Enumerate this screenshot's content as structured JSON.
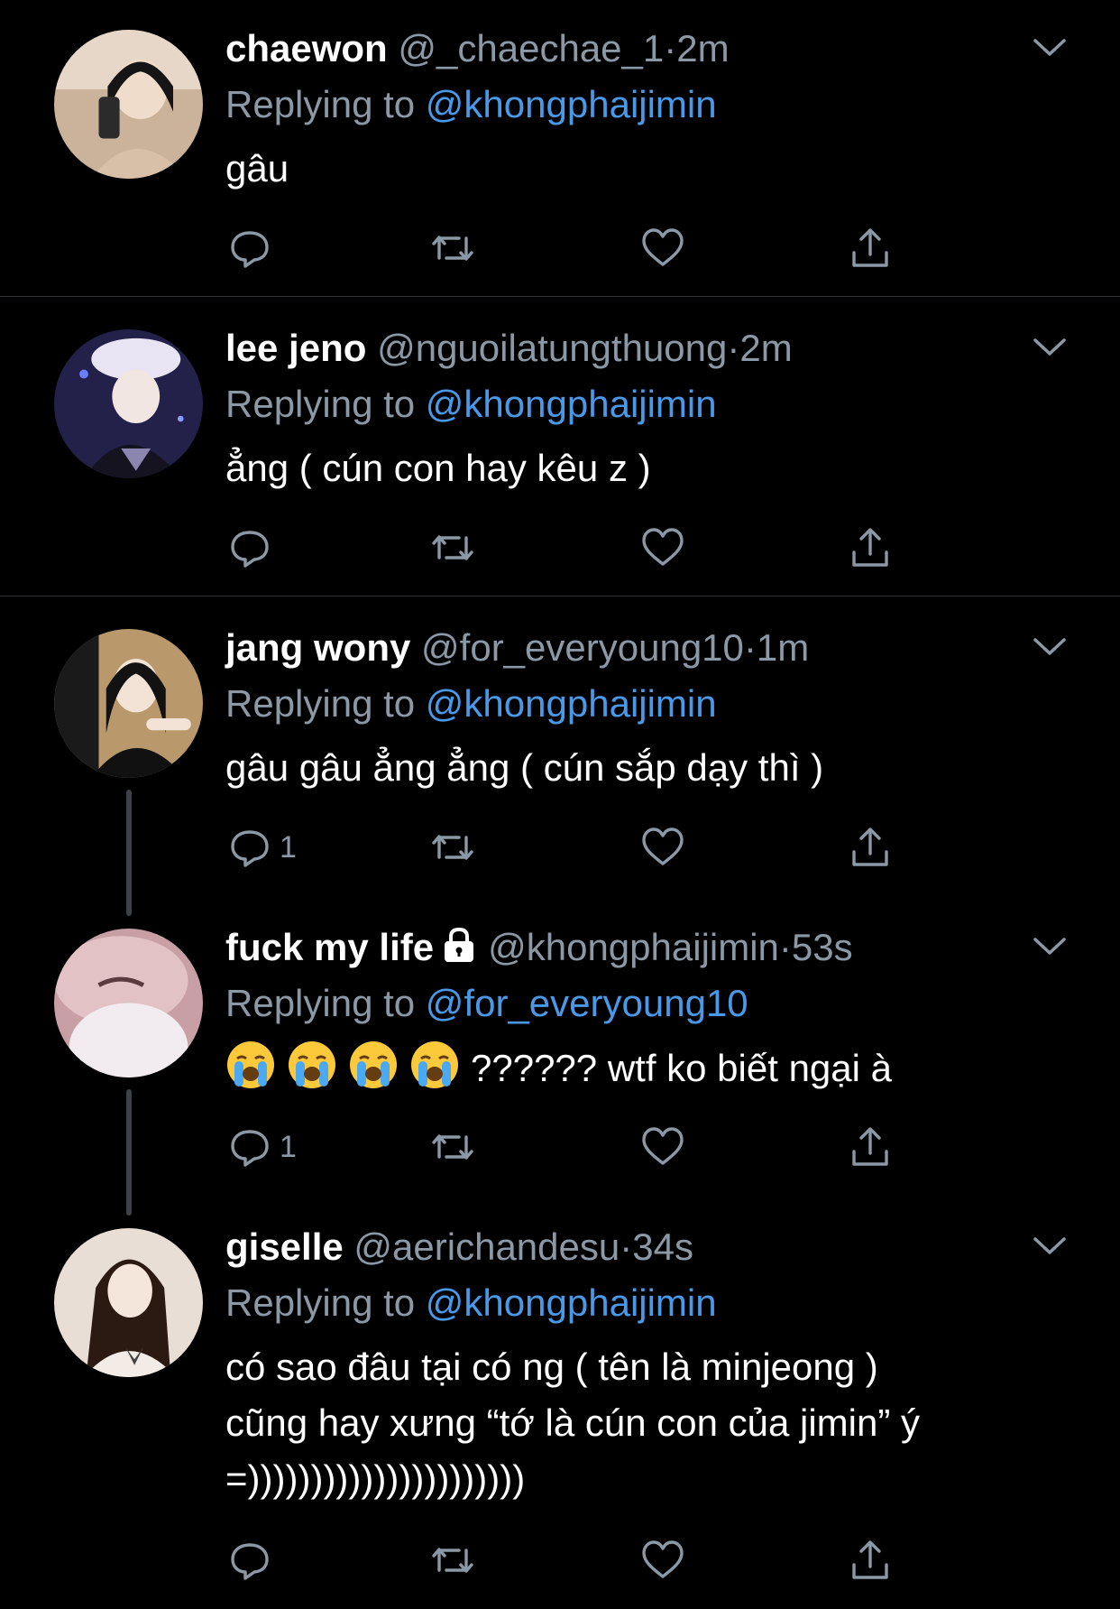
{
  "tweets": [
    {
      "name": "chaewon",
      "handle": "@_chaechae_1",
      "dot": "·",
      "time": "2m",
      "reply_prefix": "Replying to",
      "reply_to": "@khongphaijimin",
      "text_lines": [
        "gâu"
      ],
      "reply_count": "",
      "avatar_colors": [
        "#d9c3ad",
        "#1b1b1b",
        "#e8d6c4"
      ]
    },
    {
      "name": "lee jeno",
      "handle": "@nguoilatungthuong",
      "dot": "·",
      "time": "2m",
      "reply_prefix": "Replying to",
      "reply_to": "@khongphaijimin",
      "text_lines": [
        "ẳng ( cún con hay kêu z )"
      ],
      "reply_count": "",
      "avatar_colors": [
        "#2a2a55",
        "#e8e2f4",
        "#14121f"
      ]
    },
    {
      "name": "jang wony",
      "handle": "@for_everyoung10",
      "dot": "·",
      "time": "1m",
      "reply_prefix": "Replying to",
      "reply_to": "@khongphaijimin",
      "text_lines": [
        "gâu gâu ẳng ẳng ( cún sắp dạy thì )"
      ],
      "reply_count": "1",
      "avatar_colors": [
        "#b8976a",
        "#f1e1d4",
        "#111111"
      ]
    },
    {
      "name": "fuck my life",
      "handle": "@khongphaijimin",
      "dot": "·",
      "time": "53s",
      "reply_prefix": "Replying to",
      "reply_to": "@for_everyoung10",
      "text_lines": [
        "?????? wtf ko biết ngại à"
      ],
      "emoji_count": 4,
      "reply_count": "1",
      "avatar_colors": [
        "#d8b3b8",
        "#efe4ea",
        "#6e4e52"
      ]
    },
    {
      "name": "giselle",
      "handle": "@aerichandesu",
      "dot": "·",
      "time": "34s",
      "reply_prefix": "Replying to",
      "reply_to": "@khongphaijimin",
      "text_lines": [
        "có sao đâu tại có ng ( tên là minjeong )",
        "cũng hay xưng “tớ là cún con của jimin” ý",
        "=))))))))))))))))))))))"
      ],
      "reply_count": "",
      "avatar_colors": [
        "#e9dfd6",
        "#2a1a14",
        "#f3ebe5"
      ]
    }
  ],
  "icons": {
    "more": "chevron-down-icon",
    "reply": "reply-icon",
    "retweet": "retweet-icon",
    "like": "heart-icon",
    "share": "share-icon",
    "locked": "lock-icon",
    "emoji": "loudly-crying-face-emoji"
  },
  "colors": {
    "background": "#000000",
    "text": "#ffffff",
    "secondary": "#8b98a5",
    "link": "#4a99e9",
    "divider": "#2f3336"
  }
}
